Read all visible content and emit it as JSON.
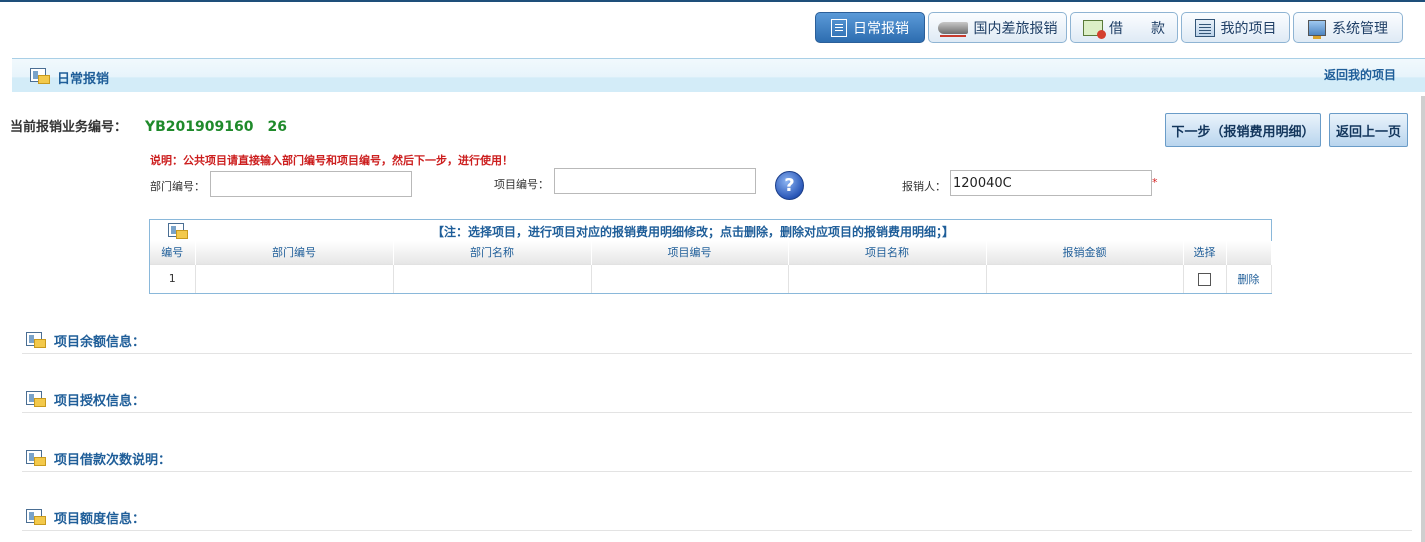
{
  "nav": {
    "tabs": [
      {
        "label": "日常报销",
        "icon": "document-icon",
        "active": true
      },
      {
        "label": "国内差旅报销",
        "icon": "train-icon",
        "active": false
      },
      {
        "label": "借　　款",
        "icon": "money-icon",
        "active": false
      },
      {
        "label": "我的项目",
        "icon": "list-icon",
        "active": false
      },
      {
        "label": "系统管理",
        "icon": "computer-icon",
        "active": false
      }
    ]
  },
  "section": {
    "title": "日常报销",
    "back_link": "返回我的项目"
  },
  "current": {
    "label": "当前报销业务编号：",
    "value": "YB201909160　26"
  },
  "buttons": {
    "next": "下一步（报销费用明细）",
    "prev": "返回上一页"
  },
  "note": "说明：公共项目请直接输入部门编号和项目编号，然后下一步，进行使用！",
  "form": {
    "dept_label": "部门编号：",
    "dept_value": "",
    "project_label": "项目编号：",
    "project_value": "",
    "reimburser_label": "报销人：",
    "reimburser_value": "120040C",
    "required_mark": "*",
    "help_glyph": "?"
  },
  "table": {
    "title": "【注：选择项目，进行项目对应的报销费用明细修改；点击删除，删除对应项目的报销费用明细；】",
    "columns": [
      "编号",
      "部门编号",
      "部门名称",
      "项目编号",
      "项目名称",
      "报销金额",
      "选择",
      ""
    ],
    "rows": [
      {
        "no": "1",
        "dept_code": "",
        "dept_name": "",
        "project_code": "",
        "project_name": "",
        "amount": "",
        "checked": false,
        "action": "删除"
      }
    ]
  },
  "info_sections": [
    "项目余额信息：",
    "项目授权信息：",
    "项目借款次数说明：",
    "项目额度信息："
  ],
  "colors": {
    "accent": "#1f5e99",
    "active_tab": "#3c7cc0",
    "green_value": "#1f8a2b",
    "red_note": "#cc1e1e"
  }
}
